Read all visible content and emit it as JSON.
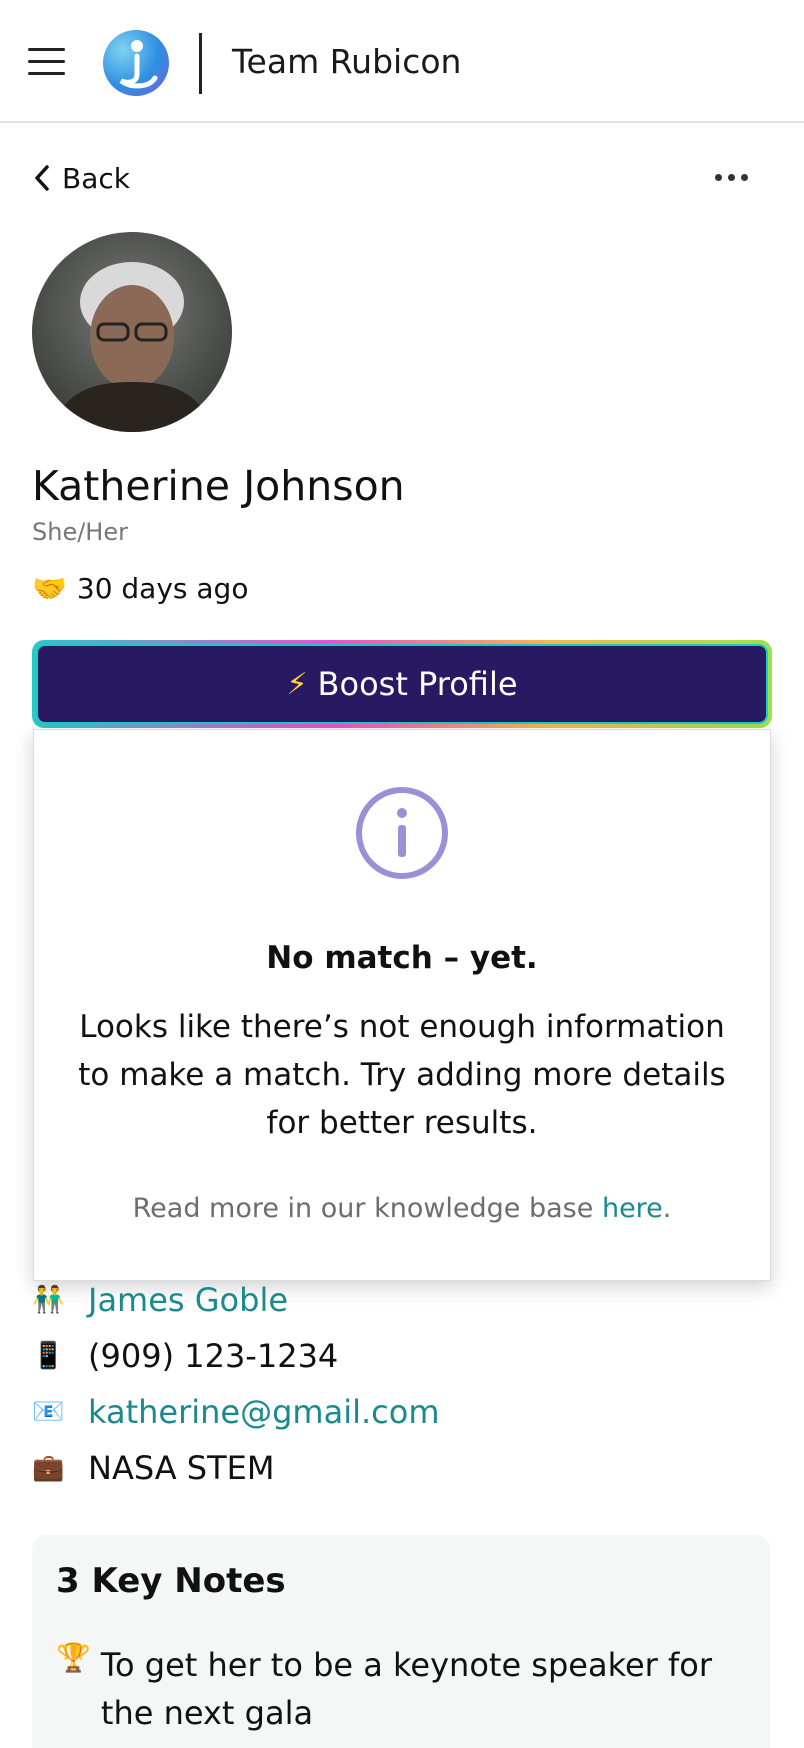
{
  "header": {
    "org_name": "Team Rubicon",
    "menu_icon": "hamburger-menu-icon",
    "logo_icon": "app-logo"
  },
  "nav": {
    "back_label": "Back",
    "more_icon": "more-options-icon"
  },
  "profile": {
    "name": "Katherine Johnson",
    "pronouns": "She/Her",
    "last_contact_emoji": "🤝",
    "last_contact": "30 days ago"
  },
  "boost": {
    "emoji": "⚡",
    "label": "Boost Profile"
  },
  "popover": {
    "icon": "info-icon",
    "title": "No match – yet.",
    "body": "Looks like there’s not enough information to make a match. Try adding more details for better results.",
    "footer_prefix": "Read more in our knowledge base ",
    "footer_link": "here",
    "footer_suffix": "."
  },
  "contacts": [
    {
      "icon": "👬",
      "text": "James Goble"
    },
    {
      "icon": "📱",
      "text": "(909) 123-1234"
    },
    {
      "icon": "📧",
      "text": "katherine@gmail.com"
    },
    {
      "icon": "💼",
      "text": "NASA STEM"
    }
  ],
  "notes": {
    "title": "3 Key Notes",
    "items": [
      {
        "icon": "🏆",
        "text": "To get her to be a keynote speaker for the next gala"
      }
    ]
  },
  "colors": {
    "brand_dark": "#271a63",
    "link_teal": "#1a8a8e",
    "info_purple": "#9b8fd6"
  }
}
